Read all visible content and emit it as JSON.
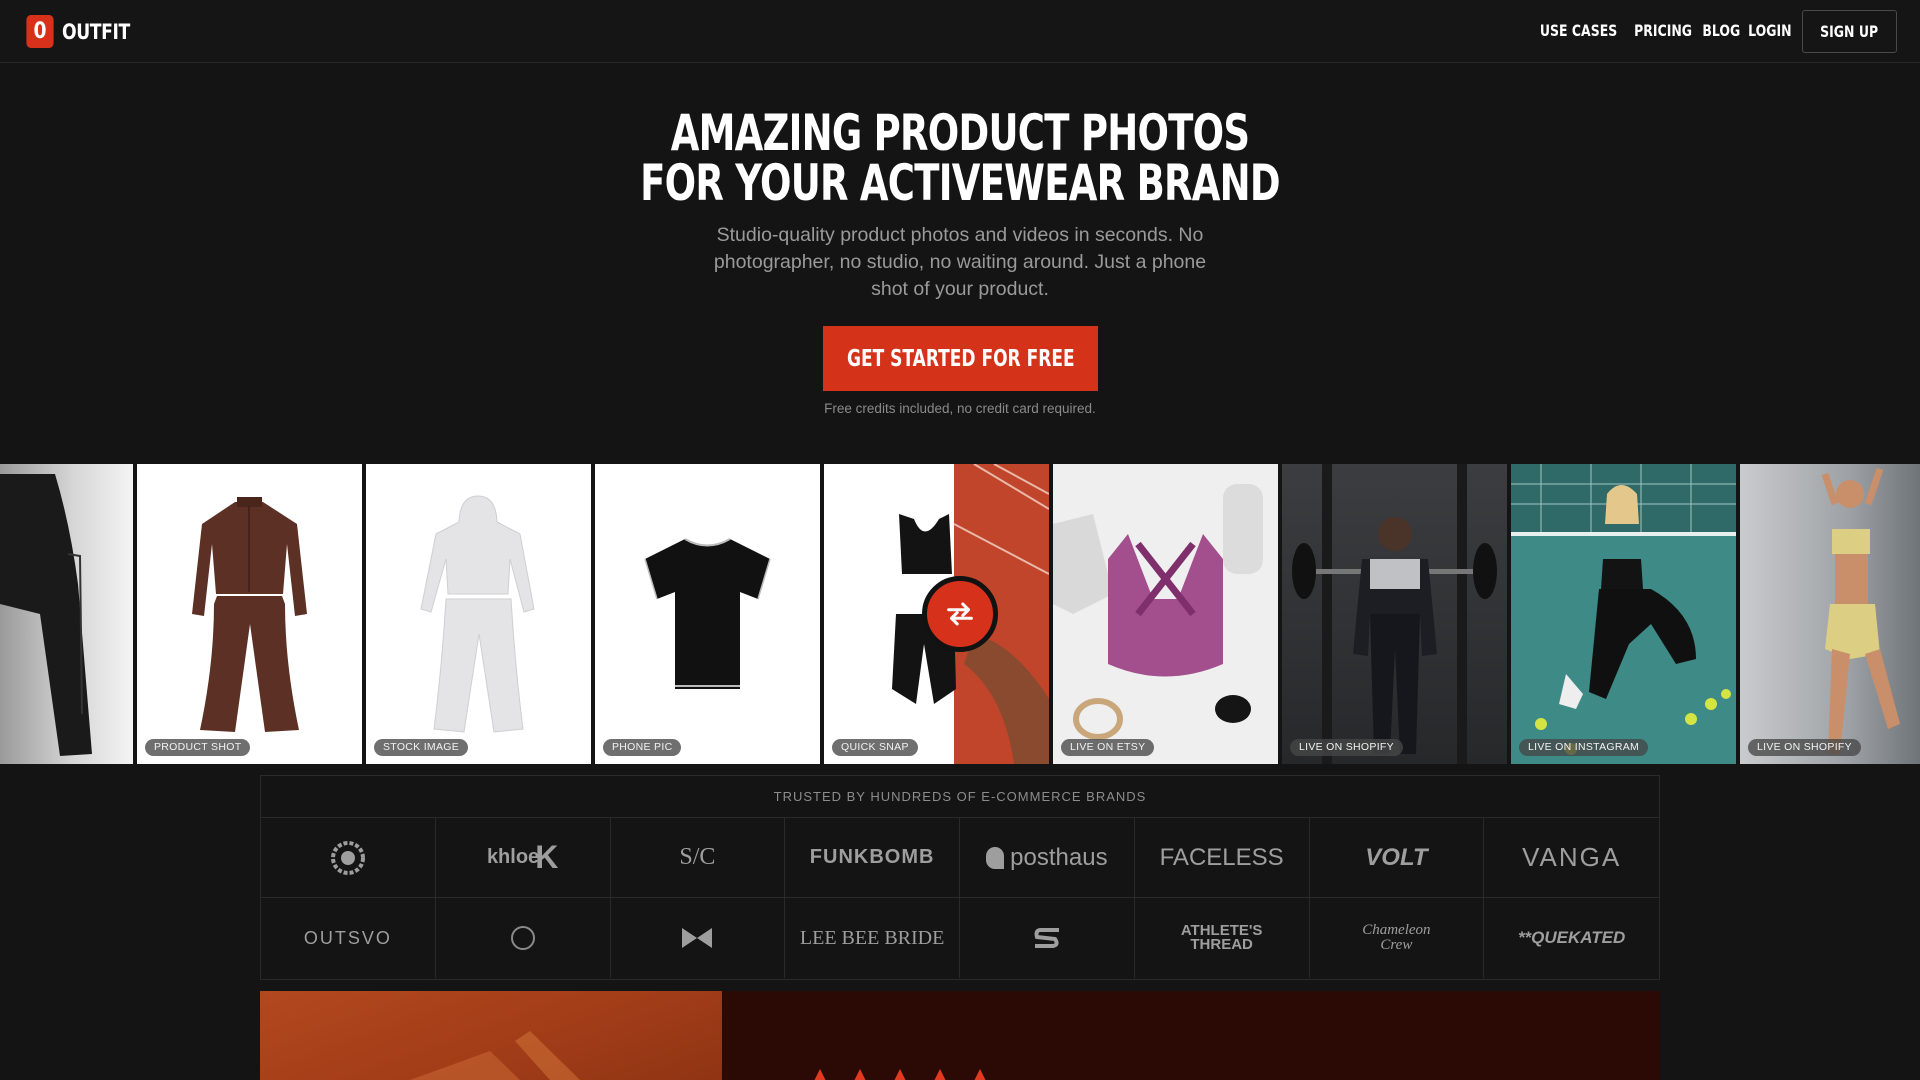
{
  "brand": {
    "logo_mark": "0",
    "name": "OUTFIT"
  },
  "nav": {
    "links": [
      "USE CASES",
      "PRICING",
      "BLOG",
      "LOGIN"
    ],
    "signup_label": "SIGN UP"
  },
  "hero": {
    "title_line1": "AMAZING PRODUCT PHOTOS",
    "title_line2": "FOR YOUR ACTIVEWEAR BRAND",
    "subtitle": "Studio-quality product photos and videos in seconds. No photographer, no studio, no waiting around. Just a phone shot of your product.",
    "cta_label": "GET STARTED FOR FREE",
    "cta_note": "Free credits included, no credit card required."
  },
  "gallery": {
    "tiles": [
      {
        "label": "PRODUCT SHOT",
        "icon": "brown-tracksuit-image"
      },
      {
        "label": "STOCK IMAGE",
        "icon": "grey-hoodie-set-image"
      },
      {
        "label": "PHONE PIC",
        "icon": "black-tshirt-image"
      },
      {
        "label": "QUICK SNAP",
        "icon": "black-sports-bra-shorts-image"
      },
      {
        "label": "LIVE ON ETSY",
        "icon": "purple-sports-bra-image"
      },
      {
        "label": "LIVE ON SHOPIFY",
        "icon": "gym-man-hoodie-image"
      },
      {
        "label": "LIVE ON INSTAGRAM",
        "icon": "tennis-court-woman-image"
      },
      {
        "label": "LIVE ON SHOPIFY",
        "icon": "yellow-activewear-woman-image"
      }
    ],
    "swap_icon": "swap-arrows-icon"
  },
  "brands": {
    "heading": "TRUSTED BY HUNDREDS OF E-COMMERCE BRANDS",
    "row1": [
      "",
      "khloe",
      "S/C",
      "FUNKBOMB",
      "posthaus",
      "FACELESS",
      "VOLT",
      "VANGA"
    ],
    "row2": [
      "OUTSVO",
      "",
      "",
      "LEE BEE BRIDE",
      "",
      "ATHLETE'S THREAD",
      "Chameleon Crew",
      "**QUEKATED"
    ]
  },
  "colors": {
    "accent": "#d5321a",
    "background": "#141414"
  }
}
